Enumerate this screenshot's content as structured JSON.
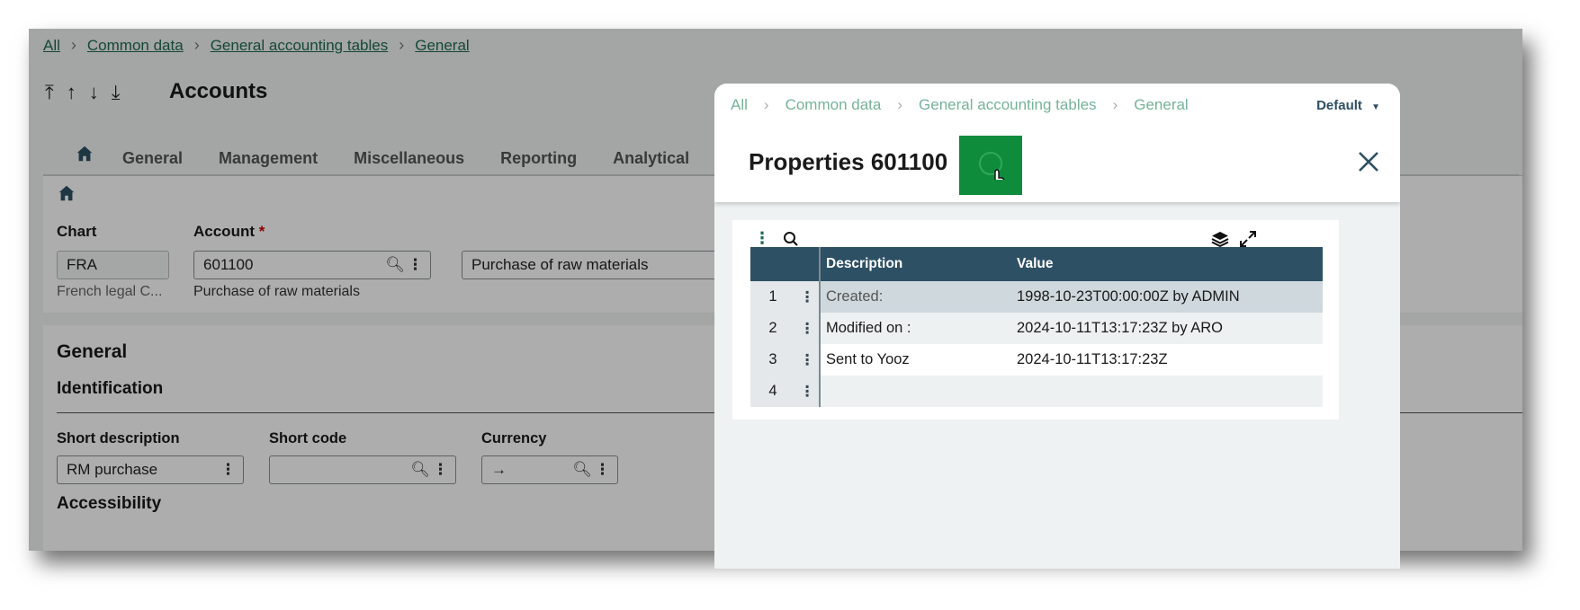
{
  "background": {
    "breadcrumb": [
      "All",
      "Common data",
      "General accounting tables",
      "General"
    ],
    "title": "Accounts",
    "tabs": [
      "General",
      "Management",
      "Miscellaneous",
      "Reporting",
      "Analytical"
    ],
    "fields": {
      "chart_label": "Chart",
      "chart_value": "FRA",
      "chart_sub": "French legal C...",
      "account_label": "Account",
      "account_required": "*",
      "account_value": "601100",
      "account_sub": "Purchase of raw materials",
      "description_value": "Purchase of raw materials"
    },
    "section": {
      "title": "General",
      "subtitle": "Identification",
      "short_description_label": "Short description",
      "short_description_value": "RM purchase",
      "short_code_label": "Short code",
      "short_code_value": "",
      "currency_label": "Currency",
      "currency_value": "→",
      "accessibility": "Accessibility"
    }
  },
  "modal": {
    "breadcrumb": [
      "All",
      "Common data",
      "General accounting tables",
      "General"
    ],
    "view_selector": "Default",
    "title": "Properties 601100",
    "columns": [
      "Description",
      "Value"
    ],
    "rows": [
      {
        "num": "1",
        "description": "Created:",
        "value": "1998-10-23T00:00:00Z by ADMIN"
      },
      {
        "num": "2",
        "description": "Modified on :",
        "value": "2024-10-11T13:17:23Z by ARO"
      },
      {
        "num": "3",
        "description": "Sent to Yooz",
        "value": "2024-10-11T13:17:23Z"
      },
      {
        "num": "4",
        "description": "",
        "value": ""
      }
    ]
  },
  "colors": {
    "accent_green": "#0e8c3c",
    "header_blue": "#2e5064",
    "link_green": "#1f6b52"
  }
}
